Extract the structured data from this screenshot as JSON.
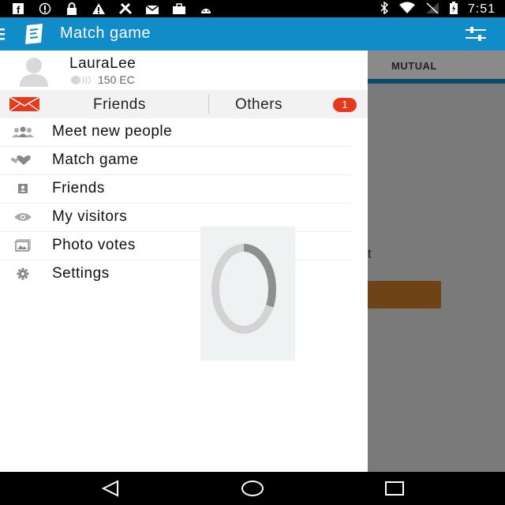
{
  "status_bar": {
    "time": "7:51",
    "icons": [
      "facebook-icon",
      "info-icon",
      "lock-icon",
      "warning-icon",
      "tools-icon",
      "mail-icon",
      "briefcase-icon",
      "android-icon",
      "bluetooth-icon",
      "wifi-icon",
      "no-signal-icon",
      "battery-charging-icon"
    ]
  },
  "app_bar": {
    "title": "Match game"
  },
  "background": {
    "tab_label": "MUTUAL",
    "text_fragment": "t",
    "button_color": "#6e4316"
  },
  "drawer": {
    "profile": {
      "name": "LauraLee",
      "coins": "150 EC"
    },
    "tabs": {
      "friends": "Friends",
      "others": "Others",
      "others_badge": "1"
    },
    "menu": [
      {
        "label": "Meet new people",
        "icon": "people-icon"
      },
      {
        "label": "Match game",
        "icon": "hearts-icon"
      },
      {
        "label": "Friends",
        "icon": "contact-card-icon"
      },
      {
        "label": "My visitors",
        "icon": "eye-icon"
      },
      {
        "label": "Photo votes",
        "icon": "photos-icon"
      },
      {
        "label": "Settings",
        "icon": "gear-icon"
      }
    ]
  },
  "colors": {
    "app_bar": "#118cc9",
    "badge": "#e53a1d",
    "envelope": "#e53a1d"
  }
}
